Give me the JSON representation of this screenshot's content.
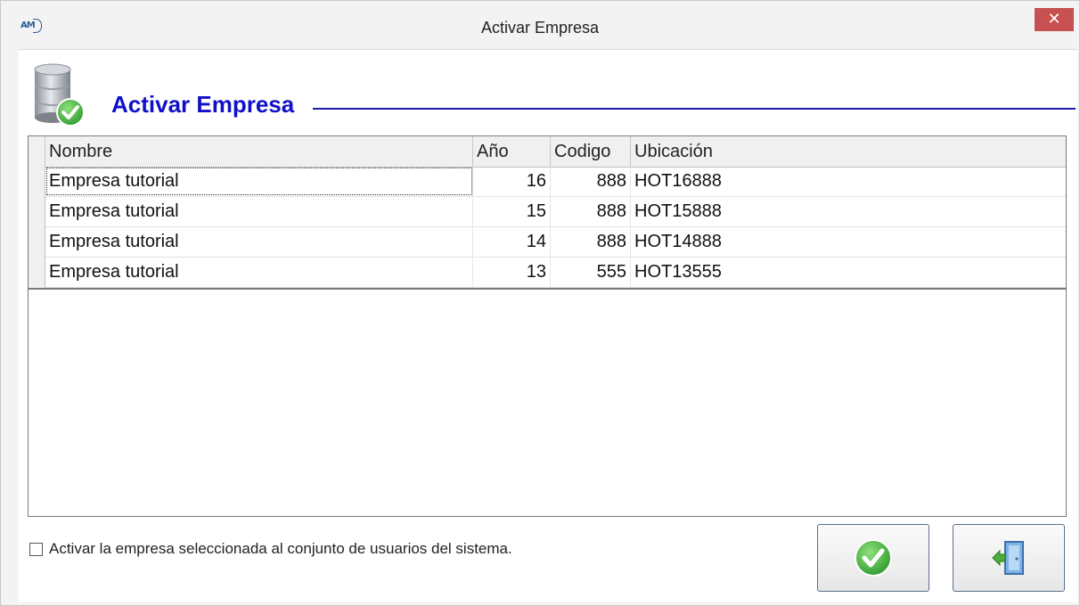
{
  "window": {
    "title": "Activar Empresa",
    "app_icon_text": "AM",
    "close_symbol": "✕"
  },
  "header": {
    "title": "Activar Empresa",
    "icon": "database-check-icon"
  },
  "grid": {
    "columns": [
      "Nombre",
      "Año",
      "Codigo",
      "Ubicación"
    ],
    "rows": [
      {
        "nombre": "Empresa tutorial",
        "anio": "16",
        "codigo": "888",
        "ubicacion": "HOT16888"
      },
      {
        "nombre": "Empresa tutorial",
        "anio": "15",
        "codigo": "888",
        "ubicacion": "HOT15888"
      },
      {
        "nombre": "Empresa tutorial",
        "anio": "14",
        "codigo": "888",
        "ubicacion": "HOT14888"
      },
      {
        "nombre": "Empresa tutorial",
        "anio": "13",
        "codigo": "555",
        "ubicacion": "HOT13555"
      }
    ]
  },
  "footer": {
    "checkbox_label": "Activar la empresa seleccionada al conjunto de usuarios del sistema.",
    "checkbox_checked": false,
    "accept_icon": "check-icon",
    "exit_icon": "exit-door-icon"
  },
  "colors": {
    "title_blue": "#1010c8",
    "close_red": "#c75050",
    "check_green": "#3aa63a"
  }
}
